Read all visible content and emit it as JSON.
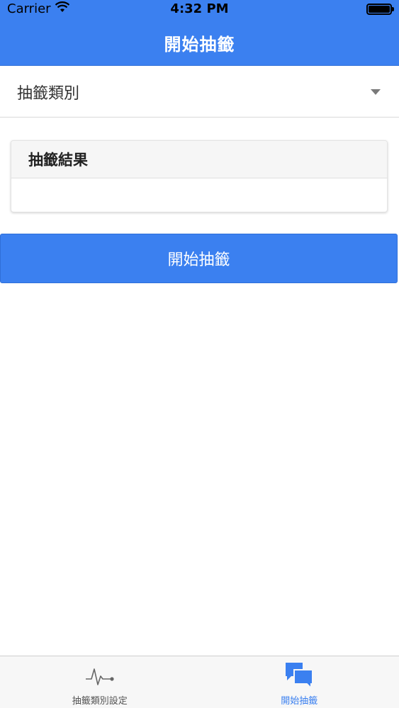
{
  "status_bar": {
    "carrier": "Carrier",
    "time": "4:32 PM"
  },
  "header": {
    "title": "開始抽籤"
  },
  "category_select": {
    "selected": "抽籤類別"
  },
  "result_card": {
    "title": "抽籤結果",
    "content": ""
  },
  "start_button": {
    "label": "開始抽籤"
  },
  "tab_bar": {
    "tabs": [
      {
        "label": "抽籤類別設定",
        "icon": "pulse-icon",
        "active": false
      },
      {
        "label": "開始抽籤",
        "icon": "chat-bubbles-icon",
        "active": true
      }
    ]
  },
  "colors": {
    "primary": "#3b80f0",
    "tab_inactive": "#555555"
  }
}
